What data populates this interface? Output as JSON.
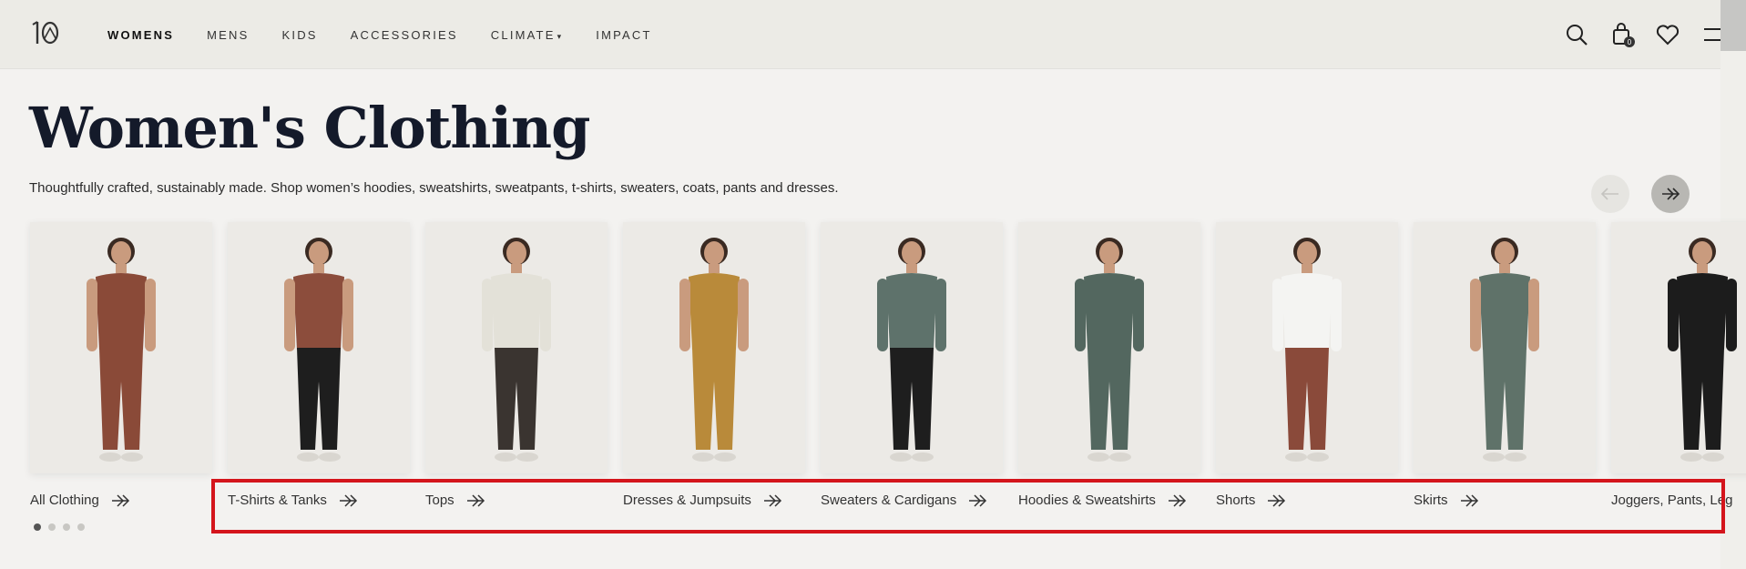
{
  "nav": {
    "items": [
      {
        "label": "WOMENS",
        "active": true
      },
      {
        "label": "MENS"
      },
      {
        "label": "KIDS"
      },
      {
        "label": "ACCESSORIES"
      },
      {
        "label": "CLIMATE",
        "has_caret": true
      },
      {
        "label": "IMPACT"
      }
    ],
    "cart_count": "0"
  },
  "page": {
    "title": "Women's Clothing",
    "subtitle": "Thoughtfully crafted, sustainably made. Shop women’s hoodies, sweatshirts, sweatpants, t-shirts, sweaters, coats, pants and dresses."
  },
  "categories": [
    {
      "label": "All Clothing",
      "garment": "#8a4a38",
      "lower": "#8a4a38"
    },
    {
      "label": "T-Shirts & Tanks",
      "garment": "#8c4d3c",
      "lower": "#1e1e1e"
    },
    {
      "label": "Tops",
      "garment": "#e3e1d8",
      "lower": "#3a3430"
    },
    {
      "label": "Dresses & Jumpsuits",
      "garment": "#b98a3a",
      "lower": "#b98a3a"
    },
    {
      "label": "Sweaters & Cardigans",
      "garment": "#5e726b",
      "lower": "#1e1e1e"
    },
    {
      "label": "Hoodies & Sweatshirts",
      "garment": "#53675f",
      "lower": "#53675f"
    },
    {
      "label": "Shorts",
      "garment": "#f4f4f2",
      "lower": "#8a4a3a"
    },
    {
      "label": "Skirts",
      "garment": "#5f7269",
      "lower": "#5f7269"
    },
    {
      "label": "Joggers, Pants, Leg",
      "garment": "#1c1c1c",
      "lower": "#1c1c1c"
    }
  ],
  "pagination": {
    "pages": 4,
    "active": 0
  }
}
